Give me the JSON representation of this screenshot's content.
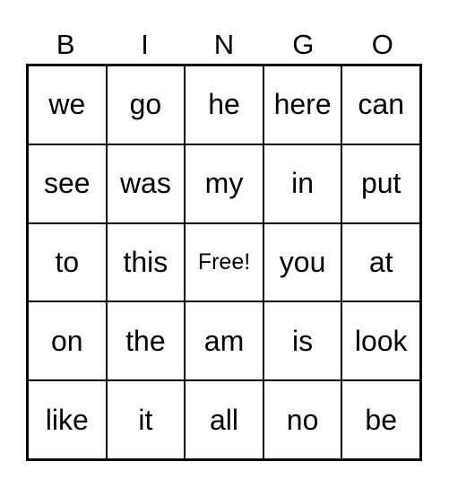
{
  "header": [
    "B",
    "I",
    "N",
    "G",
    "O"
  ],
  "cells": [
    [
      "we",
      "go",
      "he",
      "here",
      "can"
    ],
    [
      "see",
      "was",
      "my",
      "in",
      "put"
    ],
    [
      "to",
      "this",
      "Free!",
      "you",
      "at"
    ],
    [
      "on",
      "the",
      "am",
      "is",
      "look"
    ],
    [
      "like",
      "it",
      "all",
      "no",
      "be"
    ]
  ]
}
